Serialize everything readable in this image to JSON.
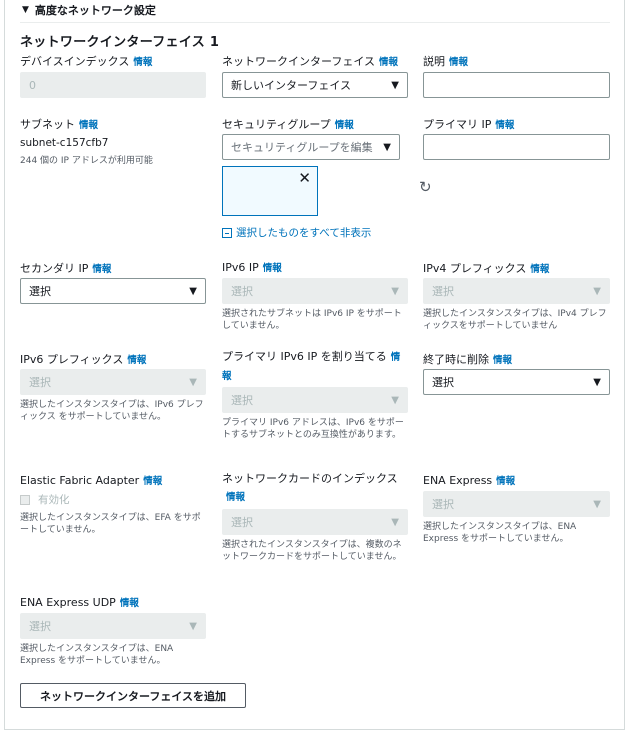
{
  "section": {
    "title": "高度なネットワーク設定"
  },
  "interface": {
    "title": "ネットワークインターフェイス 1"
  },
  "info_label": "情報",
  "device_index": {
    "label": "デバイスインデックス",
    "value": "0"
  },
  "network_interface": {
    "label": "ネットワークインターフェイス",
    "value": "新しいインターフェイス"
  },
  "description": {
    "label": "説明",
    "value": ""
  },
  "subnet": {
    "label": "サブネット",
    "value": "subnet-c157cfb7",
    "help": "244 個の IP アドレスが利用可能"
  },
  "security_groups": {
    "label": "セキュリティグループ",
    "placeholder": "セキュリティグループを編集",
    "hide_link": "選択したものをすべて非表示"
  },
  "primary_ip": {
    "label": "プライマリ IP",
    "value": ""
  },
  "secondary_ip": {
    "label": "セカンダリ IP",
    "value": "選択"
  },
  "ipv6_ip": {
    "label": "IPv6 IP",
    "value": "選択",
    "help": "選択されたサブネットは IPv6 IP をサポートしていません。"
  },
  "ipv4_prefix": {
    "label": "IPv4 プレフィックス",
    "value": "選択",
    "help": "選択したインスタンスタイプは、IPv4 プレフィックスをサポートしていません"
  },
  "ipv6_prefix": {
    "label": "IPv6 プレフィックス",
    "value": "選択",
    "help": "選択したインスタンスタイプは、IPv6 プレフィックス をサポートしていません。"
  },
  "assign_primary_ipv6": {
    "label": "プライマリ IPv6 IP を割り当てる",
    "value": "選択",
    "help": "プライマリ IPv6 アドレスは、IPv6 をサポートするサブネットとのみ互換性があります。"
  },
  "delete_on_termination": {
    "label": "終了時に削除",
    "value": "選択"
  },
  "efa": {
    "label": "Elastic Fabric Adapter",
    "checkbox_label": "有効化",
    "help": "選択したインスタンスタイプは、EFA をサポートしていません。"
  },
  "network_card_index": {
    "label": "ネットワークカードのインデックス",
    "value": "選択",
    "help": "選択されたインスタンスタイプは、複数のネットワークカードをサポートしていません。"
  },
  "ena_express": {
    "label": "ENA Express",
    "value": "選択",
    "help": "選択したインスタンスタイプは、ENA Express をサポートしていません。"
  },
  "ena_express_udp": {
    "label": "ENA Express UDP",
    "value": "選択",
    "help": "選択したインスタンスタイプは、ENA Express をサポートしていません。"
  },
  "add_button": {
    "label": "ネットワークインターフェイスを追加"
  },
  "icons": {
    "caret": "caret-down-icon",
    "close": "close-icon",
    "refresh": "refresh-icon",
    "collapse": "collapse-icon"
  }
}
